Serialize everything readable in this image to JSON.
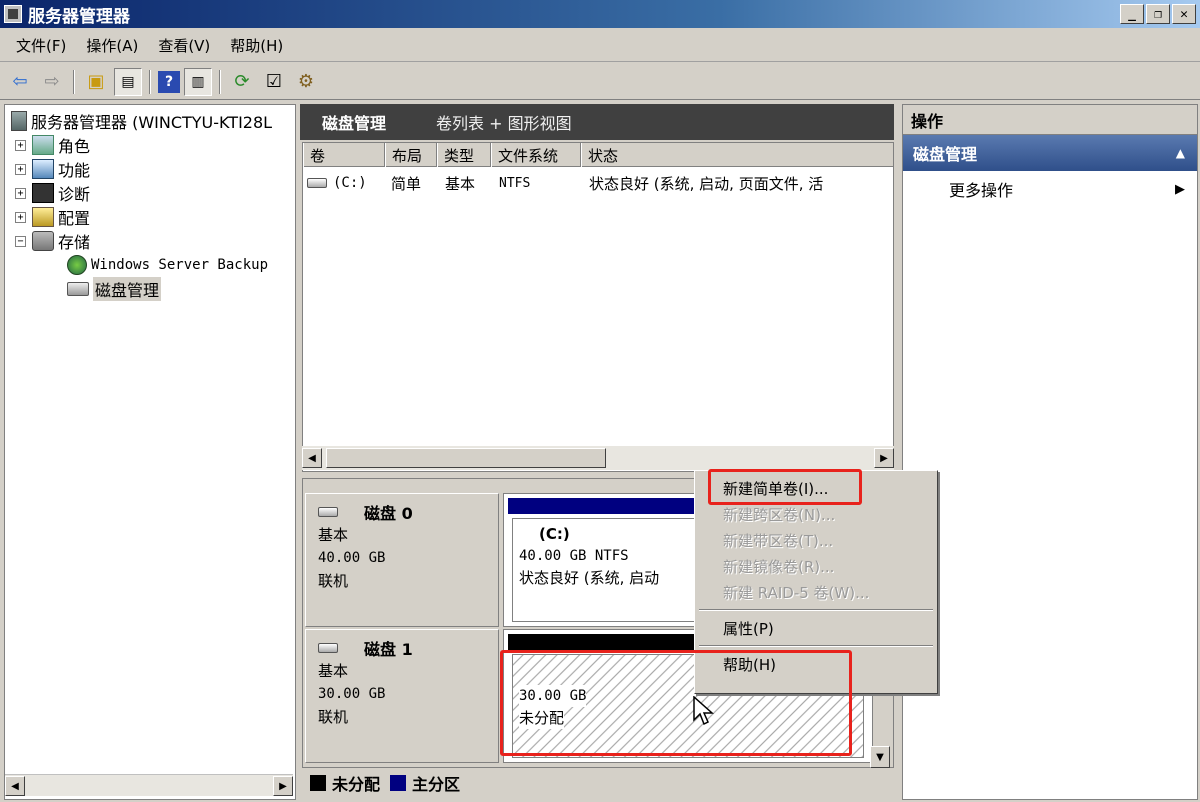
{
  "window": {
    "title": "服务器管理器",
    "controls": {
      "minimize": "_",
      "restore": "❐",
      "close": "✕"
    }
  },
  "menubar": [
    {
      "label": "文件(F)"
    },
    {
      "label": "操作(A)"
    },
    {
      "label": "查看(V)"
    },
    {
      "label": "帮助(H)"
    }
  ],
  "tree": {
    "root": "服务器管理器 (WINCTYU-KTI28L",
    "items": [
      {
        "label": "角色",
        "expander": "+"
      },
      {
        "label": "功能",
        "expander": "+"
      },
      {
        "label": "诊断",
        "expander": "+"
      },
      {
        "label": "配置",
        "expander": "+"
      },
      {
        "label": "存储",
        "expander": "−"
      }
    ],
    "children": [
      {
        "label": "Windows Server Backup"
      },
      {
        "label": "磁盘管理"
      }
    ]
  },
  "center": {
    "title": "磁盘管理",
    "views": "卷列表 + 图形视图",
    "columns": [
      "卷",
      "布局",
      "类型",
      "文件系统",
      "状态"
    ],
    "volumes": [
      {
        "volume": "(C:)",
        "layout": "简单",
        "type": "基本",
        "fs": "NTFS",
        "status": "状态良好 (系统, 启动, 页面文件, 活"
      }
    ]
  },
  "disks": [
    {
      "name": "磁盘 0",
      "type": "基本",
      "size": "40.00 GB",
      "status": "联机",
      "partition": {
        "label": "(C:)",
        "size_fs": "40.00 GB NTFS",
        "status": "状态良好 (系统, 启动"
      }
    },
    {
      "name": "磁盘 1",
      "type": "基本",
      "size": "30.00 GB",
      "status": "联机",
      "partition": {
        "size": "30.00 GB",
        "status": "未分配"
      }
    }
  ],
  "legend": [
    {
      "label": "未分配",
      "color": "#000000"
    },
    {
      "label": "主分区",
      "color": "#000080"
    }
  ],
  "actions": {
    "header": "操作",
    "section": "磁盘管理",
    "more": "更多操作"
  },
  "context_menu": {
    "items": [
      {
        "label": "新建简单卷(I)...",
        "enabled": true
      },
      {
        "label": "新建跨区卷(N)...",
        "enabled": false
      },
      {
        "label": "新建带区卷(T)...",
        "enabled": false
      },
      {
        "label": "新建镜像卷(R)...",
        "enabled": false
      },
      {
        "label": "新建 RAID-5 卷(W)...",
        "enabled": false
      }
    ],
    "properties": "属性(P)",
    "help": "帮助(H)"
  },
  "colors": {
    "highlight": "#e8221c",
    "primary_partition": "#000080",
    "unallocated": "#000000"
  }
}
